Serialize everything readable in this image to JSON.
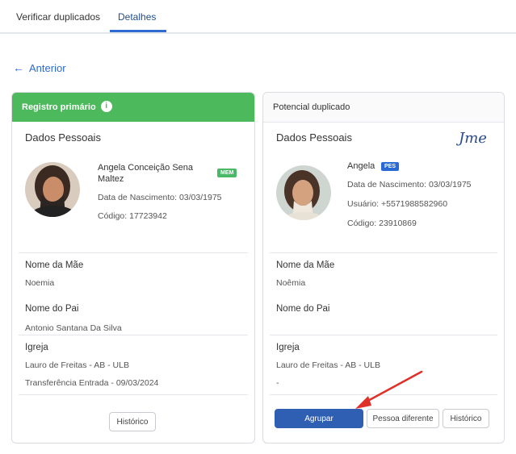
{
  "tabs": [
    {
      "label": "Verificar duplicados"
    },
    {
      "label": "Detalhes"
    }
  ],
  "back": {
    "label": "Anterior"
  },
  "left": {
    "header": "Registro primário",
    "section_title": "Dados Pessoais",
    "name": "Angela Conceição Sena Maltez",
    "badge": "MEM",
    "birth": "Data de Nascimento: 03/03/1975",
    "code": "Código: 17723942",
    "mother_label": "Nome da Mãe",
    "mother_value": "Noemia",
    "father_label": "Nome do Pai",
    "father_value": "Antonio Santana Da Silva",
    "church_label": "Igreja",
    "church_value": "Lauro de Freitas - AB - ULB",
    "transfer": "Transferência Entrada - 09/03/2024",
    "history_btn": "Histórico"
  },
  "right": {
    "header": "Potencial duplicado",
    "section_title": "Dados Pessoais",
    "signature": "Jme",
    "name": "Angela",
    "badge": "PES",
    "birth": "Data de Nascimento: 03/03/1975",
    "user": "Usuário: +5571988582960",
    "code": "Código: 23910869",
    "mother_label": "Nome da Mãe",
    "mother_value": "Noêmia",
    "father_label": "Nome do Pai",
    "church_label": "Igreja",
    "church_value": "Lauro de Freitas - AB - ULB",
    "church_extra": "-",
    "group_btn": "Agrupar",
    "different_btn": "Pessoa diferente",
    "history_btn": "Histórico"
  },
  "colors": {
    "primary_header": "#4cba5c",
    "accent_blue": "#2a6ad3",
    "primary_button": "#2f5fb3",
    "annotation_arrow": "#e0302a"
  }
}
